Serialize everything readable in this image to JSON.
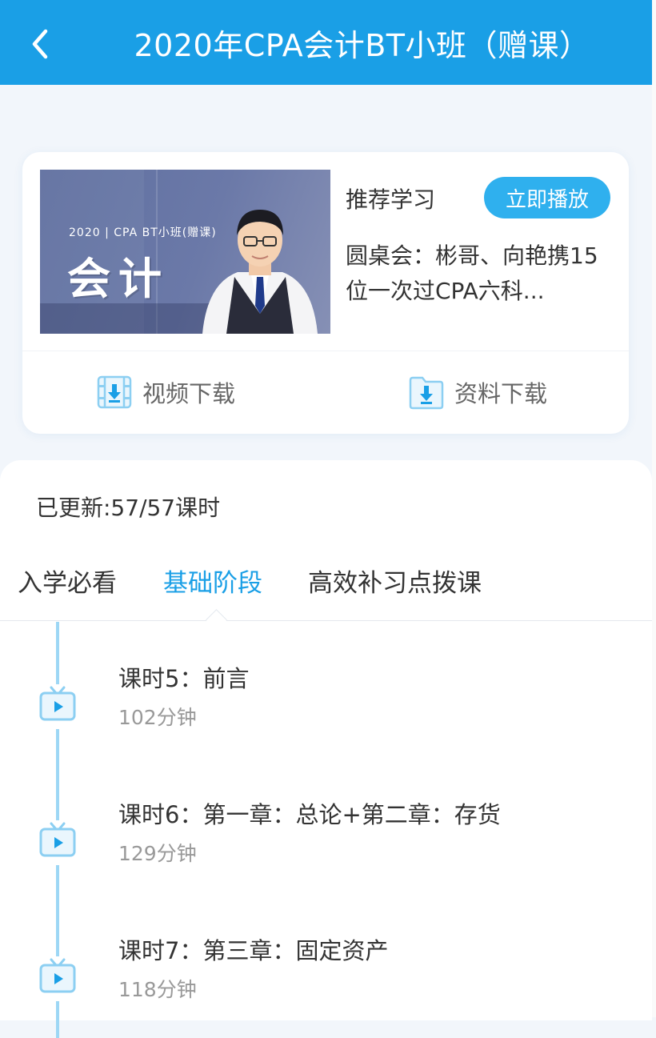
{
  "header": {
    "title": "2020年CPA会计BT小班（赠课）"
  },
  "card": {
    "thumbnail": {
      "subtitle": "2020 | CPA BT小班(赠课)",
      "big_text": "会计"
    },
    "recommend_label": "推荐学习",
    "play_button": "立即播放",
    "recommend_title": "圆桌会：彬哥、向艳携15位一次过CPA六科...",
    "video_download": "视频下载",
    "doc_download": "资料下载"
  },
  "panel": {
    "updated": "已更新:57/57课时",
    "tabs": [
      {
        "label": "入学必看"
      },
      {
        "label": "基础阶段",
        "active": true
      },
      {
        "label": "高效补习点拨课"
      }
    ],
    "lessons": [
      {
        "name": "课时5：前言",
        "duration": "102分钟"
      },
      {
        "name": "课时6：第一章：总论+第二章：存货",
        "duration": "129分钟"
      },
      {
        "name": "课时7：第三章：固定资产",
        "duration": "118分钟"
      }
    ]
  },
  "colors": {
    "primary": "#1a9fe6",
    "button": "#2fb0ee",
    "timeline": "#9dd7f5",
    "background": "#f2f6fb"
  },
  "icons": [
    "back-arrow-icon",
    "video-download-icon",
    "doc-download-icon",
    "tv-play-icon"
  ]
}
